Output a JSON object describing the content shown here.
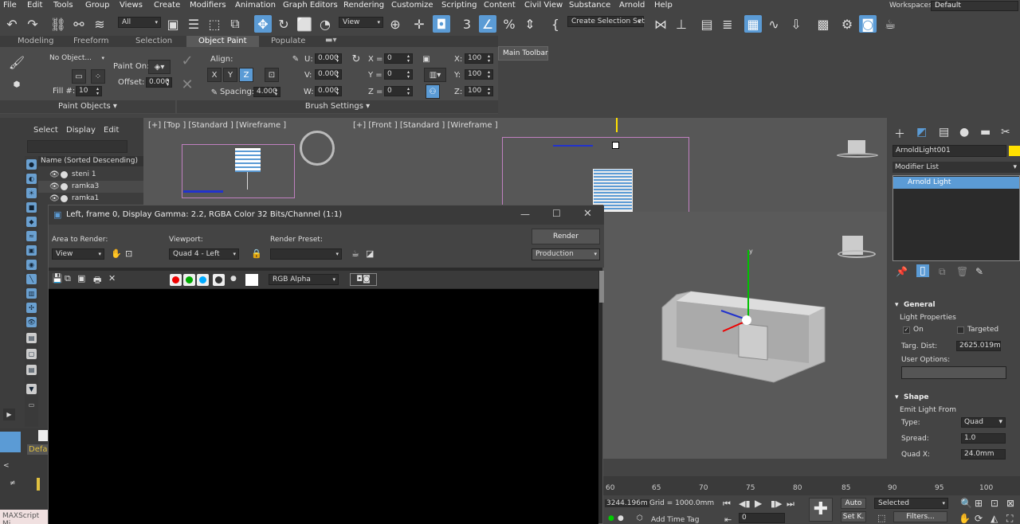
{
  "menu": [
    "File",
    "Edit",
    "Tools",
    "Group",
    "Views",
    "Create",
    "Modifiers",
    "Animation",
    "Graph Editors",
    "Rendering",
    "Customize",
    "Scripting",
    "Content",
    "Civil View",
    "Substance",
    "Arnold",
    "Help"
  ],
  "workspaces": {
    "label": "Workspaces:",
    "value": "Default"
  },
  "toolbar": {
    "filter": "All",
    "ref_coord": "View",
    "selection_set": "Create Selection Set",
    "tooltip": "Main Toolbar"
  },
  "ribbon_tabs": [
    "Modeling",
    "Freeform",
    "Selection",
    "Object Paint",
    "Populate"
  ],
  "object_paint": {
    "object": "No Object...",
    "paint_on": "Paint On:",
    "offset_label": "Offset:",
    "offset": "0.000",
    "fill_label": "Fill #:",
    "fill": "10",
    "align_label": "Align:",
    "x": "X",
    "y": "Y",
    "z": "Z",
    "spacing_label": "Spacing:",
    "spacing": "4.000",
    "u_label": "U:",
    "u": "0.000",
    "v_label": "V:",
    "v": "0.000",
    "w_label": "W:",
    "w": "0.000",
    "rx_label": "X =",
    "rx": "0",
    "ry_label": "Y =",
    "ry": "0",
    "rz_label": "Z =",
    "rz": "0",
    "sx_label": "X:",
    "sx": "100",
    "sy_label": "Y:",
    "sy": "100",
    "sz_label": "Z:",
    "sz": "100",
    "paint_objects": "Paint Objects",
    "brush_settings": "Brush Settings"
  },
  "scene_explorer": {
    "tabs": [
      "Select",
      "Display",
      "Edit"
    ],
    "header": "Name (Sorted Descending)",
    "rows": [
      "steni 1",
      "ramka3",
      "ramka1"
    ]
  },
  "viewports": {
    "top": "[+] [Top ] [Standard ] [Wireframe ]",
    "front": "[+] [Front ] [Standard ] [Wireframe ]"
  },
  "render_window": {
    "title": "Left, frame 0, Display Gamma: 2.2, RGBA Color 32 Bits/Channel (1:1)",
    "area_label": "Area to Render:",
    "area": "View",
    "viewport_label": "Viewport:",
    "viewport": "Quad 4 - Left",
    "preset_label": "Render Preset:",
    "preset": "",
    "render_btn": "Render",
    "production": "Production",
    "channel": "RGB Alpha"
  },
  "command_panel": {
    "object_name": "ArnoldLight001",
    "modifier_list": "Modifier List",
    "stack_item": "Arnold Light",
    "general": "General",
    "light_properties": "Light Properties",
    "on": "On",
    "targeted": "Targeted",
    "targ_dist_label": "Targ. Dist:",
    "targ_dist": "2625.019m",
    "user_options": "User Options:",
    "shape": "Shape",
    "emit_from": "Emit Light From",
    "type_label": "Type:",
    "type": "Quad",
    "spread_label": "Spread:",
    "spread": "1.0",
    "quadx_label": "Quad X:",
    "quadx": "24.0mm"
  },
  "timeline": {
    "ticks": [
      "60",
      "65",
      "70",
      "75",
      "80",
      "85",
      "90",
      "95",
      "100"
    ]
  },
  "status": {
    "coord": "3244.196m",
    "grid": "Grid = 1000.0mm",
    "add_time_tag": "Add Time Tag",
    "auto": "Auto",
    "selected": "Selected",
    "setk": "Set K.",
    "filters": "Filters...",
    "frame": "0"
  },
  "bottom_left": {
    "default": "Defau",
    "maxscript": "MAXScript Mi"
  },
  "colors": {
    "accent": "#5b9bd5",
    "object_color": "#ffe000"
  }
}
